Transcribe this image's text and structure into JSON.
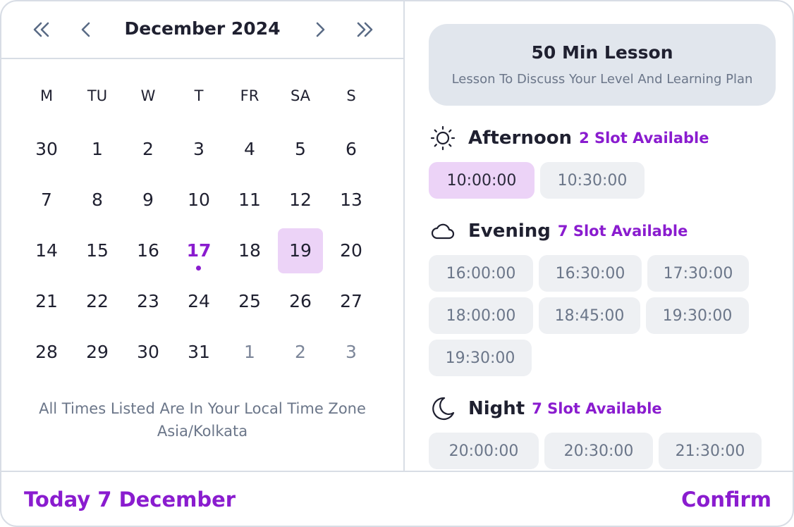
{
  "calendar": {
    "month_label": "December 2024",
    "weekdays": [
      "M",
      "TU",
      "W",
      "T",
      "FR",
      "SA",
      "S"
    ],
    "weeks": [
      [
        "30",
        "1",
        "2",
        "3",
        "4",
        "5",
        "6"
      ],
      [
        "7",
        "8",
        "9",
        "10",
        "11",
        "12",
        "13"
      ],
      [
        "14",
        "15",
        "16",
        "17",
        "18",
        "19",
        "20"
      ],
      [
        "21",
        "22",
        "23",
        "24",
        "25",
        "26",
        "27"
      ],
      [
        "28",
        "29",
        "30",
        "31",
        "1",
        "2",
        "3"
      ]
    ],
    "today_day": "17",
    "selected_day": "19",
    "timezone_note": "All Times Listed Are In Your Local Time Zone",
    "timezone": "Asia/Kolkata"
  },
  "lesson": {
    "title": "50 Min Lesson",
    "subtitle": "Lesson To Discuss Your Level And Learning Plan"
  },
  "sections": {
    "afternoon": {
      "label": "Afternoon",
      "count": "2 Slot Available",
      "slots": [
        "10:00:00",
        "10:30:00"
      ]
    },
    "evening": {
      "label": "Evening",
      "count": "7 Slot Available",
      "slots": [
        "16:00:00",
        "16:30:00",
        "17:30:00",
        "18:00:00",
        "18:45:00",
        "19:30:00",
        "19:30:00"
      ]
    },
    "night": {
      "label": "Night",
      "count": "7 Slot Available",
      "slots": [
        "20:00:00",
        "20:30:00",
        "21:30:00"
      ]
    }
  },
  "footer": {
    "today_label": "Today 7 December",
    "confirm_label": "Confirm"
  },
  "colors": {
    "accent": "#8a1ccf",
    "selected_bg": "#ecd3f7",
    "slot_bg": "#eef0f3",
    "card_bg": "#e1e6ed"
  }
}
